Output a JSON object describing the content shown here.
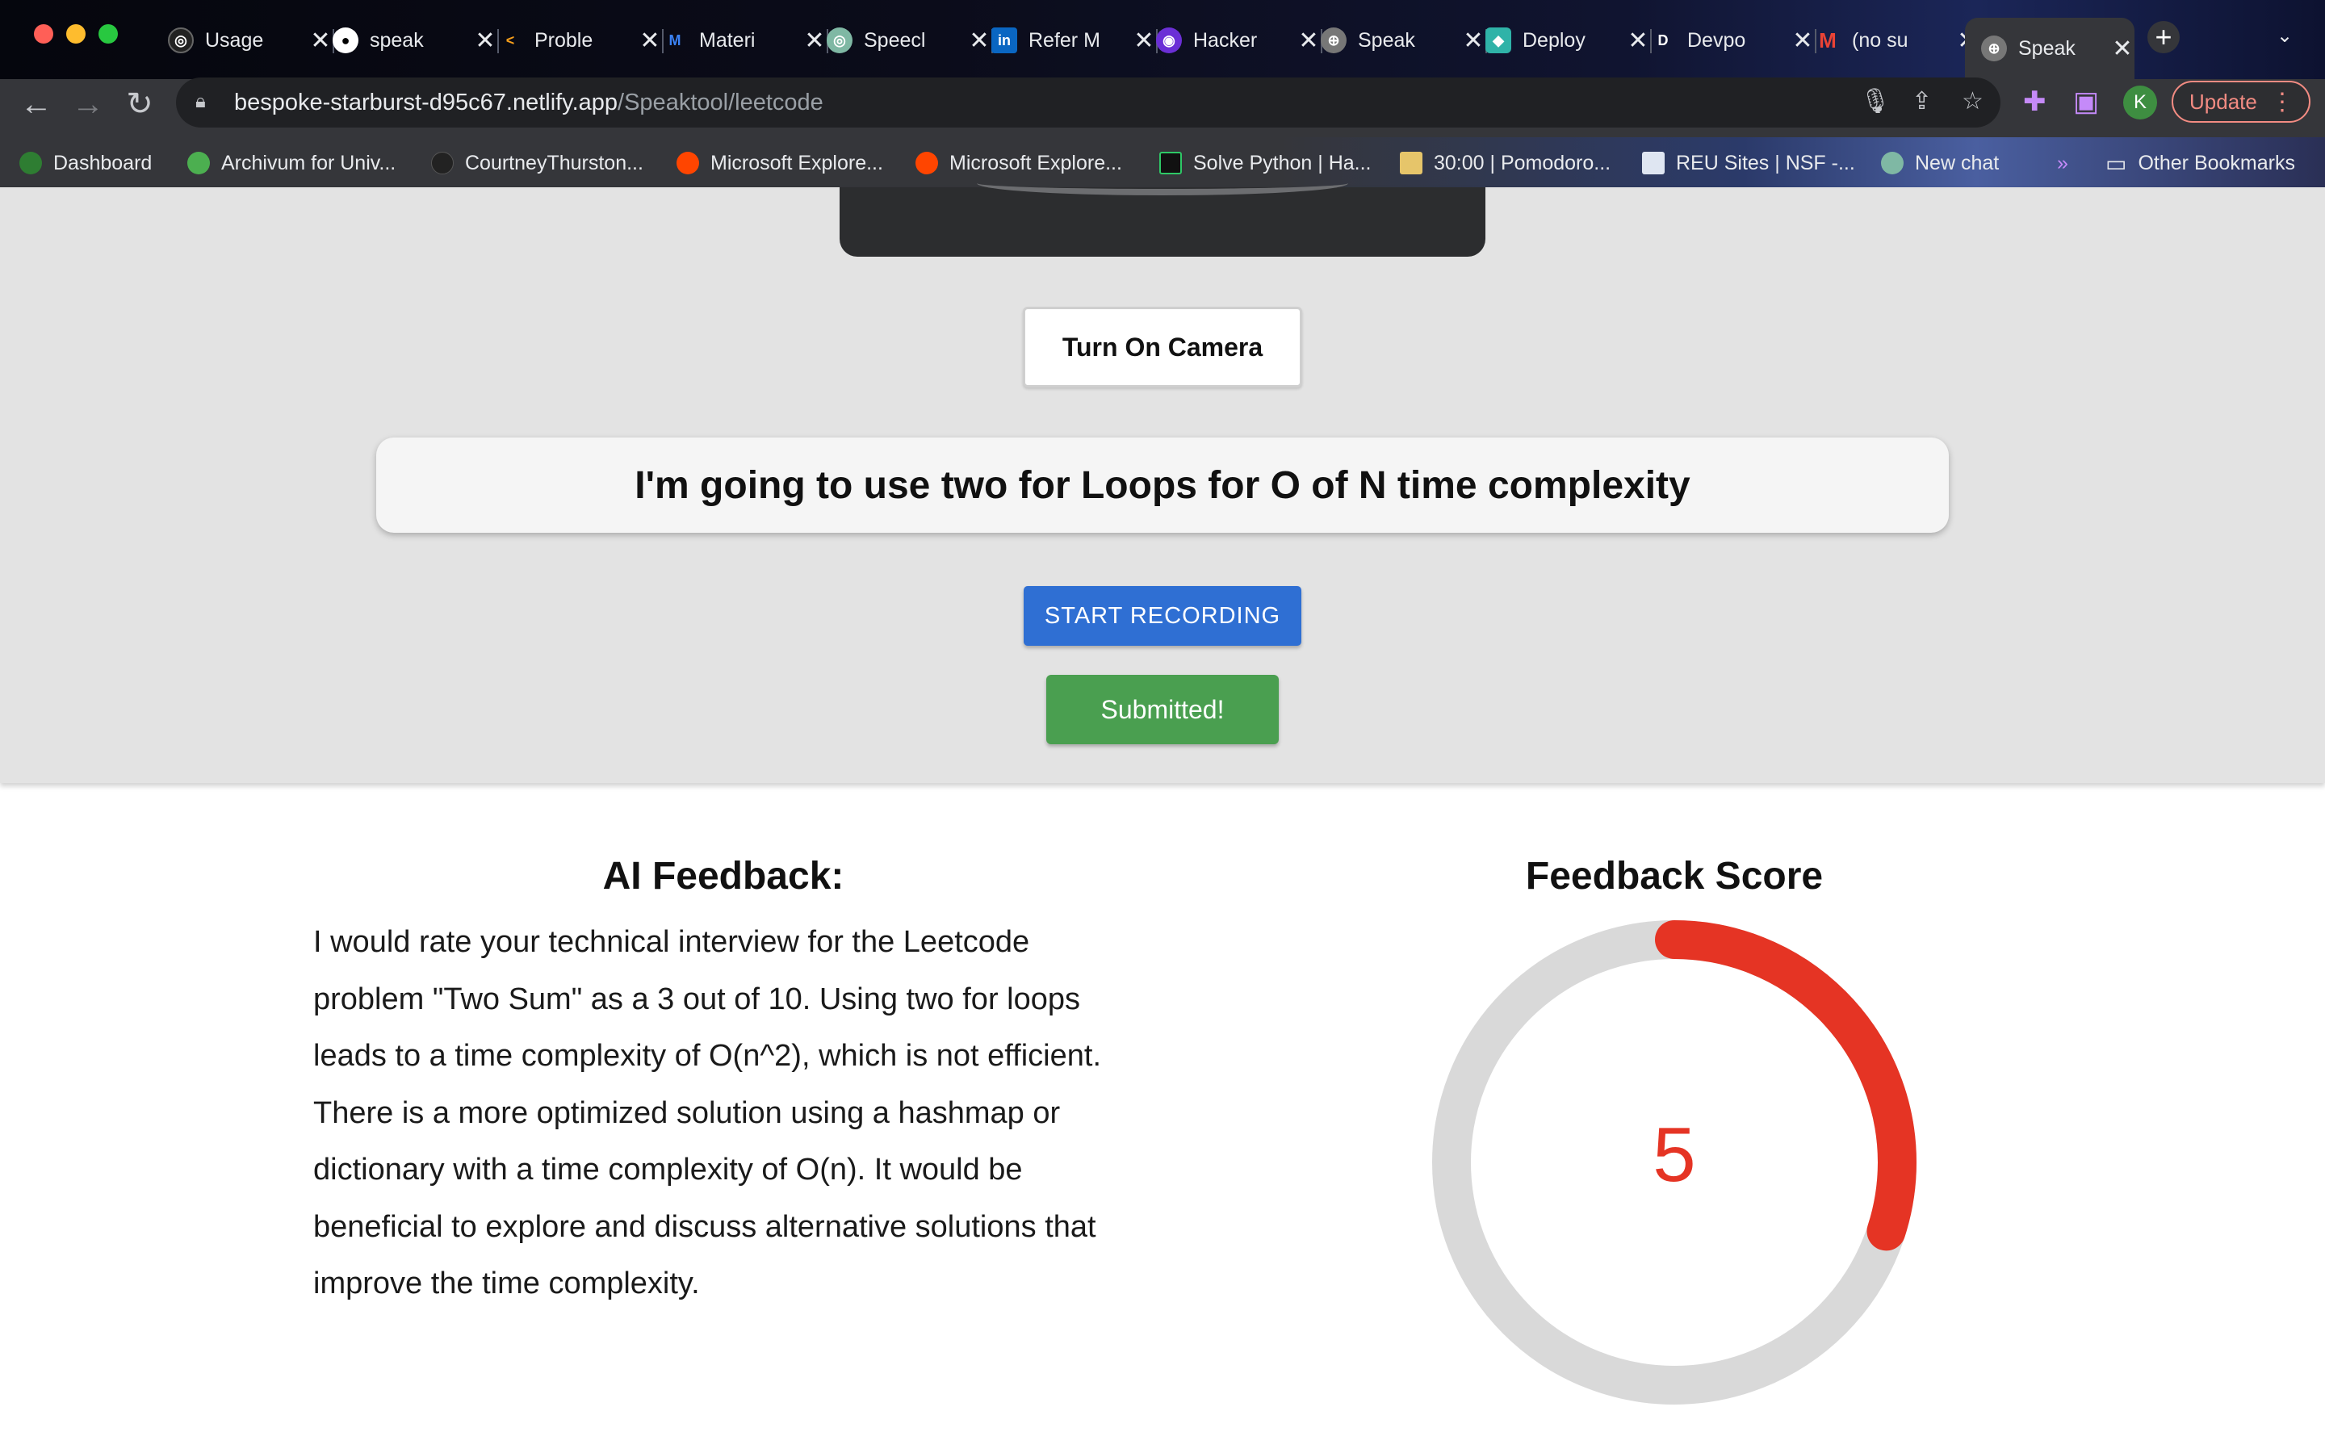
{
  "browser": {
    "tabs": [
      {
        "title": "Usage",
        "icon": "openai-icon"
      },
      {
        "title": "speak",
        "icon": "github-icon"
      },
      {
        "title": "Proble",
        "icon": "leetcode-icon"
      },
      {
        "title": "Materi",
        "icon": "mui-icon"
      },
      {
        "title": "Speecl",
        "icon": "openai-icon"
      },
      {
        "title": "Refer M",
        "icon": "linkedin-icon"
      },
      {
        "title": "Hacker",
        "icon": "hackerearth-icon"
      },
      {
        "title": "Speak",
        "icon": "globe-icon"
      },
      {
        "title": "Deploy",
        "icon": "netlify-icon"
      },
      {
        "title": "Devpo",
        "icon": "devpost-icon"
      },
      {
        "title": "(no su",
        "icon": "gmail-icon"
      },
      {
        "title": "Speak",
        "icon": "globe-icon",
        "active": true
      }
    ],
    "url_host": "bespoke-starburst-d95c67.netlify.app",
    "url_path": "/Speaktool/leetcode",
    "update_label": "Update",
    "profile_initial": "K",
    "bookmarks": [
      {
        "label": "Dashboard"
      },
      {
        "label": "Archivum for Univ..."
      },
      {
        "label": "CourtneyThurston..."
      },
      {
        "label": "Microsoft Explore..."
      },
      {
        "label": "Microsoft Explore..."
      },
      {
        "label": "Solve Python | Ha..."
      },
      {
        "label": "30:00 | Pomodoro..."
      },
      {
        "label": "REU Sites | NSF -..."
      },
      {
        "label": "New chat"
      }
    ],
    "bookmarks_overflow": "»",
    "other_bookmarks": "Other Bookmarks"
  },
  "page": {
    "camera_button": "Turn On Camera",
    "transcript": "I'm going to use two for Loops for O of N time complexity",
    "record_button": "START RECORDING",
    "submitted_button": "Submitted!",
    "feedback_title": "AI Feedback:",
    "feedback_text": "I would rate your technical interview for the Leetcode problem \"Two Sum\" as a 3 out of 10. Using two for loops leads to a time complexity of O(n^2), which is not efficient. There is a more optimized solution using a hashmap or dictionary with a time complexity of O(n). It would be beneficial to explore and discuss alternative solutions that improve the time complexity.",
    "score_title": "Feedback Score",
    "score_value": "5",
    "score_fraction": 0.3,
    "score_color": "#e53424",
    "track_color": "#d9d9d9"
  }
}
